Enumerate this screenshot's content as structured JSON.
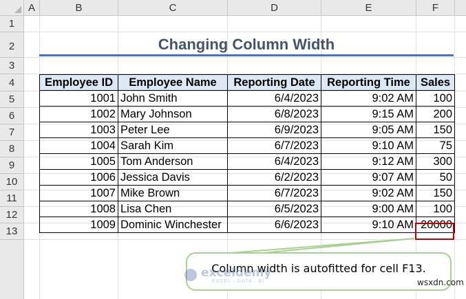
{
  "spreadsheet": {
    "columns": [
      "A",
      "B",
      "C",
      "D",
      "E",
      "F"
    ],
    "rows": [
      "1",
      "2",
      "3",
      "4",
      "5",
      "6",
      "7",
      "8",
      "9",
      "10",
      "11",
      "12",
      "13"
    ],
    "title": "Changing Column Width",
    "headers": [
      "Employee ID",
      "Employee Name",
      "Reporting Date",
      "Reporting Time",
      "Sales"
    ],
    "data": [
      [
        "1001",
        "John Smith",
        "6/4/2023",
        "9:02 AM",
        "100"
      ],
      [
        "1002",
        "Mary Johnson",
        "6/8/2023",
        "9:15 AM",
        "200"
      ],
      [
        "1003",
        "Peter Lee",
        "6/9/2023",
        "9:05 AM",
        "150"
      ],
      [
        "1004",
        "Sarah Kim",
        "6/7/2023",
        "9:10 AM",
        "75"
      ],
      [
        "1005",
        "Tom Anderson",
        "6/4/2023",
        "9:12 AM",
        "300"
      ],
      [
        "1006",
        "Jessica Davis",
        "6/2/2023",
        "9:07 AM",
        "50"
      ],
      [
        "1007",
        "Mike Brown",
        "6/7/2023",
        "9:02 AM",
        "150"
      ],
      [
        "1008",
        "Lisa Chen",
        "6/5/2023",
        "9:00 AM",
        "100"
      ],
      [
        "1009",
        "Dominic Winchester",
        "6/6/2023",
        "9:10 AM",
        "20000"
      ]
    ]
  },
  "callout": {
    "text": "Column width is autofitted for cell F13."
  },
  "watermark": {
    "name": "exceldemy",
    "tagline": "EXCEL · DATA · BI"
  },
  "corner_mark": "wsxdn.com",
  "colors": {
    "title": "#44546a",
    "accent": "#4472c4",
    "selection": "#c00000",
    "callout_border": "#a9d18e"
  }
}
